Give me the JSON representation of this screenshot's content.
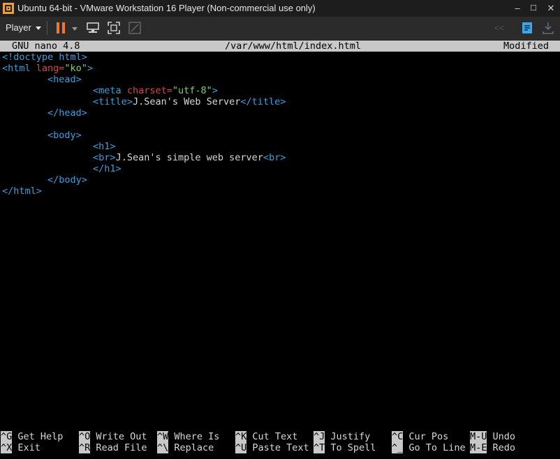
{
  "window": {
    "title": "Ubuntu 64-bit - VMware Workstation 16 Player (Non-commercial use only)",
    "controls": {
      "minimize": "–",
      "maximize": "☐",
      "close": "✕"
    }
  },
  "toolbar": {
    "player_label": "Player"
  },
  "nano": {
    "app": "GNU nano 4.8",
    "file": "/var/www/html/index.html",
    "status": "Modified"
  },
  "editor": {
    "lines": [
      [
        {
          "t": "tag",
          "v": "<!doctype html>"
        }
      ],
      [
        {
          "t": "tag",
          "v": "<html "
        },
        {
          "t": "attr",
          "v": "lang="
        },
        {
          "t": "str",
          "v": "\"ko\""
        },
        {
          "t": "tag",
          "v": ">"
        }
      ],
      [
        {
          "t": "txt",
          "v": "        "
        },
        {
          "t": "tag",
          "v": "<head>"
        }
      ],
      [
        {
          "t": "txt",
          "v": "                "
        },
        {
          "t": "tag",
          "v": "<meta "
        },
        {
          "t": "attr",
          "v": "charset="
        },
        {
          "t": "str",
          "v": "\"utf-8\""
        },
        {
          "t": "tag",
          "v": ">"
        }
      ],
      [
        {
          "t": "txt",
          "v": "                "
        },
        {
          "t": "tag",
          "v": "<title>"
        },
        {
          "t": "txt",
          "v": "J.Sean's Web Server"
        },
        {
          "t": "tag",
          "v": "</title>"
        }
      ],
      [
        {
          "t": "txt",
          "v": "        "
        },
        {
          "t": "tag",
          "v": "</head>"
        }
      ],
      [
        {
          "t": "txt",
          "v": ""
        }
      ],
      [
        {
          "t": "txt",
          "v": "        "
        },
        {
          "t": "tag",
          "v": "<body>"
        }
      ],
      [
        {
          "t": "txt",
          "v": "                "
        },
        {
          "t": "tag",
          "v": "<h1>"
        }
      ],
      [
        {
          "t": "txt",
          "v": "                "
        },
        {
          "t": "tag",
          "v": "<br>"
        },
        {
          "t": "txt",
          "v": "J.Sean's simple web server"
        },
        {
          "t": "tag",
          "v": "<br>"
        }
      ],
      [
        {
          "t": "txt",
          "v": "                "
        },
        {
          "t": "tag",
          "v": "</h1>"
        }
      ],
      [
        {
          "t": "txt",
          "v": "        "
        },
        {
          "t": "tag",
          "v": "</body>"
        }
      ],
      [
        {
          "t": "tag",
          "v": "</html>"
        }
      ]
    ]
  },
  "shortcuts": {
    "row1": [
      {
        "key": "^G",
        "label": "Get Help"
      },
      {
        "key": "^O",
        "label": "Write Out"
      },
      {
        "key": "^W",
        "label": "Where Is"
      },
      {
        "key": "^K",
        "label": "Cut Text"
      },
      {
        "key": "^J",
        "label": "Justify"
      },
      {
        "key": "^C",
        "label": "Cur Pos"
      },
      {
        "key": "M-U",
        "label": "Undo"
      }
    ],
    "row2": [
      {
        "key": "^X",
        "label": "Exit"
      },
      {
        "key": "^R",
        "label": "Read File"
      },
      {
        "key": "^\\",
        "label": "Replace"
      },
      {
        "key": "^U",
        "label": "Paste Text"
      },
      {
        "key": "^T",
        "label": "To Spell"
      },
      {
        "key": "^_",
        "label": "Go To Line"
      },
      {
        "key": "M-E",
        "label": "Redo"
      }
    ]
  }
}
